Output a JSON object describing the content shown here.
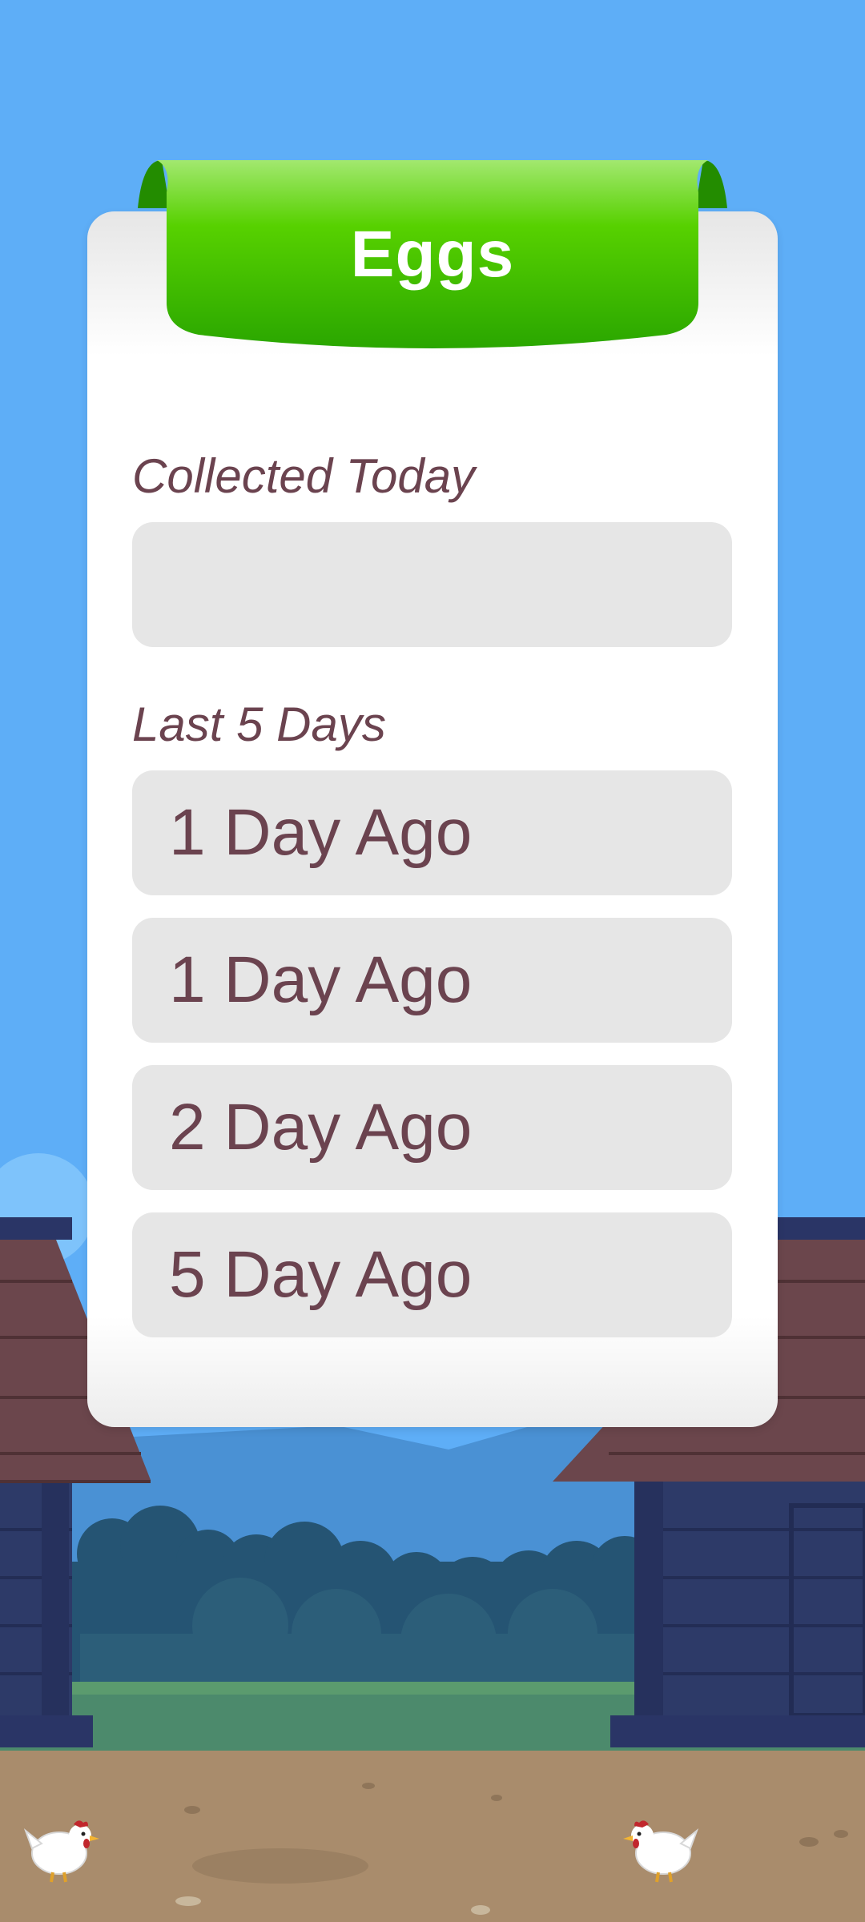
{
  "header": {
    "title": "Eggs"
  },
  "today": {
    "label": "Collected Today",
    "value": ""
  },
  "history": {
    "label": "Last 5 Days",
    "items": [
      {
        "label": "1 Day Ago"
      },
      {
        "label": "1 Day Ago"
      },
      {
        "label": "2 Day Ago"
      },
      {
        "label": "5 Day Ago"
      }
    ]
  },
  "icons": {
    "left_chicken": "chicken-icon",
    "right_chicken": "chicken-icon"
  },
  "colors": {
    "sky": "#5eaef7",
    "ribbon_green": "#3cc000",
    "text": "#6b434f",
    "field": "#e6e6e6",
    "ground": "#a98c6c"
  }
}
